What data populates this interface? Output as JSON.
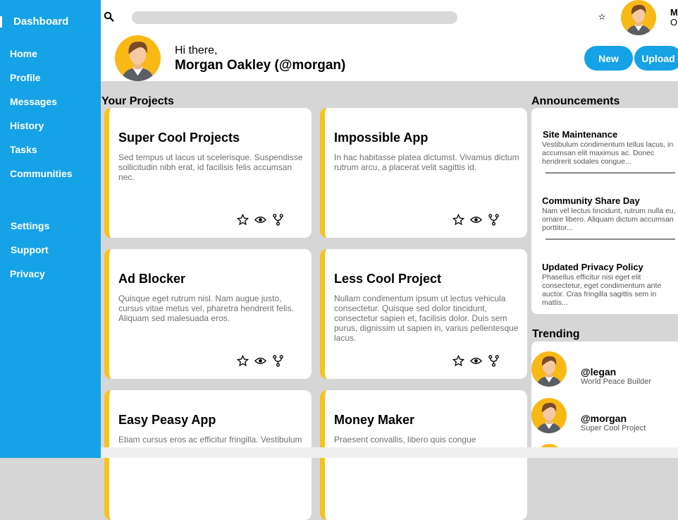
{
  "sidebar": {
    "title": "Dashboard",
    "items": [
      "Home",
      "Profile",
      "Messages",
      "History",
      "Tasks",
      "Communities"
    ],
    "secondary": [
      "Settings",
      "Support",
      "Privacy"
    ]
  },
  "header": {
    "search_icon": "search-icon",
    "notification_icon": "star-icon",
    "user_name_initial": "M",
    "user_name_initial2": "O",
    "greeting": "Hi there,",
    "full_name": "Morgan Oakley (@morgan)",
    "new_label": "New",
    "upload_label": "Upload"
  },
  "projects": {
    "heading": "Your Projects",
    "cards": [
      {
        "title": "Super Cool Projects",
        "desc": "Sed tempus ut lacus ut scelerisque. Suspendisse sollicitudin nibh erat, id facilisis felis accumsan nec."
      },
      {
        "title": "Impossible App",
        "desc": "In hac habitasse platea dictumst. Vivamus dictum rutrum arcu, a placerat velit sagittis id."
      },
      {
        "title": "Ad Blocker",
        "desc": "Quisque eget rutrum nisl. Nam augue justo, cursus vitae metus vel, pharetra hendrerit felis. Aliquam sed malesuada eros."
      },
      {
        "title": "Less Cool Project",
        "desc": "Nullam condimentum ipsum ut lectus vehicula consectetur. Quisque sed dolor tincidunt, consectetur sapien et, facilisis dolor. Duis sem purus, dignissim ut sapien in, varius pellentesque lacus."
      },
      {
        "title": "Easy Peasy App",
        "desc": "Etiam cursus eros ac efficitur fringilla. Vestibulum"
      },
      {
        "title": "Money Maker",
        "desc": "Praesent convallis, libero quis congue"
      }
    ]
  },
  "announcements": {
    "heading": "Announcements",
    "items": [
      {
        "title": "Site Maintenance",
        "desc": "Vestibulum condimentum tellus lacus, in accumsan elit maximus ac. Donec hendrerit sodales congue..."
      },
      {
        "title": "Community Share Day",
        "desc": "Nam vel lectus tincidunt, rutrum nulla eu, ornare libero. Aliquam dictum accumsan porttitor..."
      },
      {
        "title": "Updated Privacy Policy",
        "desc": "Phasellus efficitur nisi eget elit consectetur, eget condimentum ante auctor. Cras fringilla sagittis sem in mattis..."
      }
    ]
  },
  "trending": {
    "heading": "Trending",
    "items": [
      {
        "handle": "@legan",
        "subtitle": "World Peace Builder"
      },
      {
        "handle": "@morgan",
        "subtitle": "Super Cool Project"
      }
    ]
  },
  "colors": {
    "accent": "#16a2e6",
    "card_accent": "#f8c21b",
    "avatar_bg": "#f8b916"
  }
}
